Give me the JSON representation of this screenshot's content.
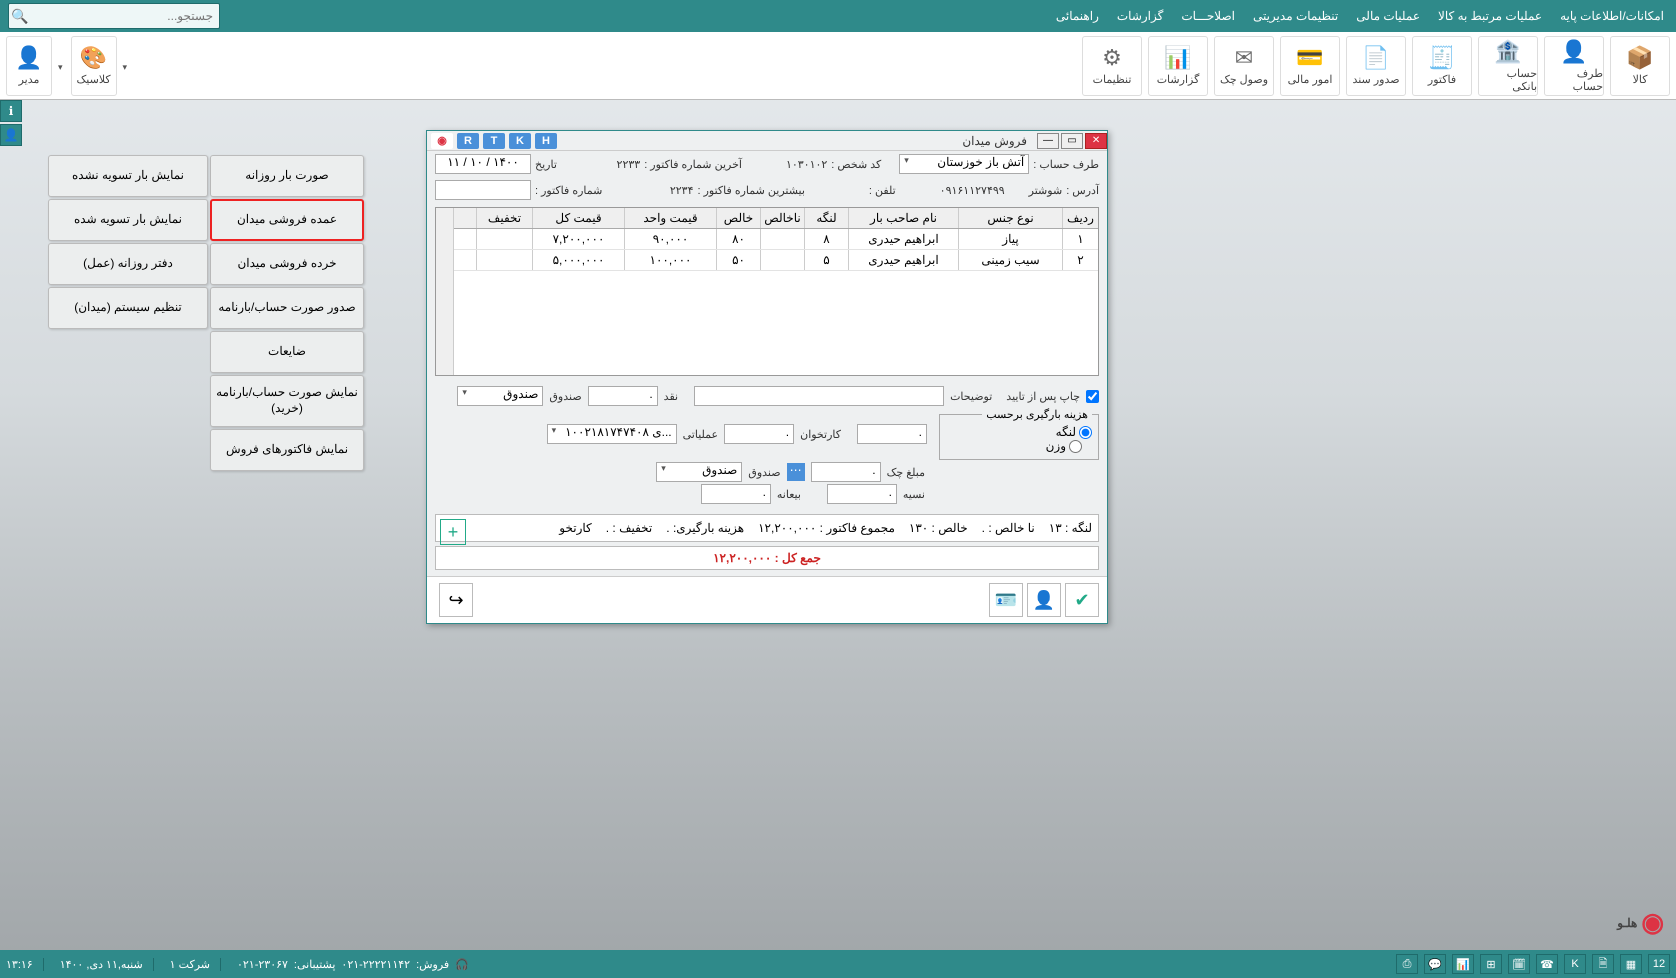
{
  "menu": [
    "امکانات/اطلاعات پایه",
    "عملیات مرتبط به کالا",
    "عملیات مالی",
    "تنظیمات مدیریتی",
    "اصلاحـــات",
    "گزارشات",
    "راهنمائی"
  ],
  "search_placeholder": "جستجو...",
  "ribbon": [
    {
      "l": "کالا",
      "i": "📦"
    },
    {
      "l": "طرف حساب",
      "i": "👤"
    },
    {
      "l": "حساب بانکی",
      "i": "🏦"
    },
    {
      "l": "فاکتور",
      "i": "🧾"
    },
    {
      "l": "صدور سند",
      "i": "📄"
    },
    {
      "l": "امور مالی",
      "i": "💳"
    },
    {
      "l": "وصول چک",
      "i": "✉"
    },
    {
      "l": "گزارشات",
      "i": "📊"
    },
    {
      "l": "تنظیمات",
      "i": "⚙"
    }
  ],
  "ribbon_left": [
    {
      "l": "کلاسیک",
      "i": "🎨"
    },
    {
      "l": "مدیر",
      "i": "👤"
    }
  ],
  "panelA": [
    "صورت بار روزانه",
    "عمده فروشی میدان",
    "خرده فروشی میدان",
    "صدور صورت حساب/بارنامه",
    "ضایعات",
    "نمایش صورت حساب/بارنامه (خرید)",
    "نمایش فاکتورهای فروش"
  ],
  "panelB": [
    "نمایش بار تسویه نشده",
    "نمایش بار تسویه شده",
    "دفتر روزانه (عمل)",
    "تنظیم سیستم (میدان)"
  ],
  "modal": {
    "title": "فروش میدان",
    "chips": [
      "H",
      "K",
      "T",
      "R"
    ],
    "row1": {
      "account_l": "طرف حساب :",
      "account_v": "آتش باز خوزستان",
      "code_l": "کد شخص :",
      "code_v": "۱۰۳۰۱۰۲",
      "last_l": "آخرین شماره فاکتور :",
      "last_v": "۲۲۳۳",
      "date_l": "تاریخ",
      "date_v": "۱۴۰۰ / ۱۰ / ۱۱"
    },
    "row2": {
      "addr_l": "آدرس :",
      "addr_v": "شوشتر",
      "mob_v": "۰۹۱۶۱۱۲۷۴۹۹",
      "tel_l": "تلفن :",
      "max_l": "بیشترین شماره فاکتور :",
      "max_v": "۲۲۳۴",
      "inv_l": "شماره فاکتور :"
    },
    "cols": [
      "ردیف",
      "نوع جنس",
      "نام صاحب بار",
      "لنگه",
      "ناخالص",
      "خالص",
      "قیمت واحد",
      "قیمت کل",
      "تخفیف"
    ],
    "rows": [
      {
        "i": "۱",
        "type": "پیاز",
        "owner": "ابراهیم حیدری",
        "lng": "۸",
        "nakh": "",
        "kh": "۸۰",
        "unit": "۹۰,۰۰۰",
        "total": "۷,۲۰۰,۰۰۰",
        "disc": ""
      },
      {
        "i": "۲",
        "type": "سیب زمینی",
        "owner": "ابراهیم حیدری",
        "lng": "۵",
        "nakh": "",
        "kh": "۵۰",
        "unit": "۱۰۰,۰۰۰",
        "total": "۵,۰۰۰,۰۰۰",
        "disc": ""
      }
    ],
    "bottom": {
      "print_l": "چاپ پس از تایید",
      "desc_l": "توضیحات",
      "cash_l": "نقد",
      "box_l": "صندوق",
      "box_v": "صندوق",
      "loadcost_l": "هزینه بارگیری برحسب",
      "r1": "لنگه",
      "r2": "وزن",
      "pos_l": "کارتخوان",
      "op_l": "عملیاتی",
      "op_v": "...ی ۱۰۰۲۱۸۱۷۴۷۴۰۸",
      "chk_l": "مبلغ چک",
      "box2_l": "صندوق",
      "box2_v": "صندوق",
      "dep_l": "بیعانه",
      "cred_l": "نسیه"
    },
    "totals": {
      "lng": "لنگه : ۱۳",
      "nakh": "نا خالص : .",
      "kh": "خالص : ۱۳۰",
      "sum": "مجموع فاکتور : ۱۲,۲۰۰,۰۰۰",
      "load": "هزینه بارگیری: .",
      "disc": "تخفیف : .",
      "pos": "کارتخو"
    },
    "grand_l": "جمع کل :",
    "grand_v": "۱۲,۲۰۰,۰۰۰"
  },
  "footer": {
    "time": "۱۳:۱۶",
    "date": "شنبه,۱۱ دی, ۱۴۰۰",
    "company": "شرکت ۱",
    "support": "۰۲۱-۲۳۰۶۷",
    "support_l": "پشتیبانی:",
    "sales": "۰۲۱-۲۲۲۲۱۱۴۲",
    "sales_l": "فروش:"
  },
  "brand": "هلـو"
}
